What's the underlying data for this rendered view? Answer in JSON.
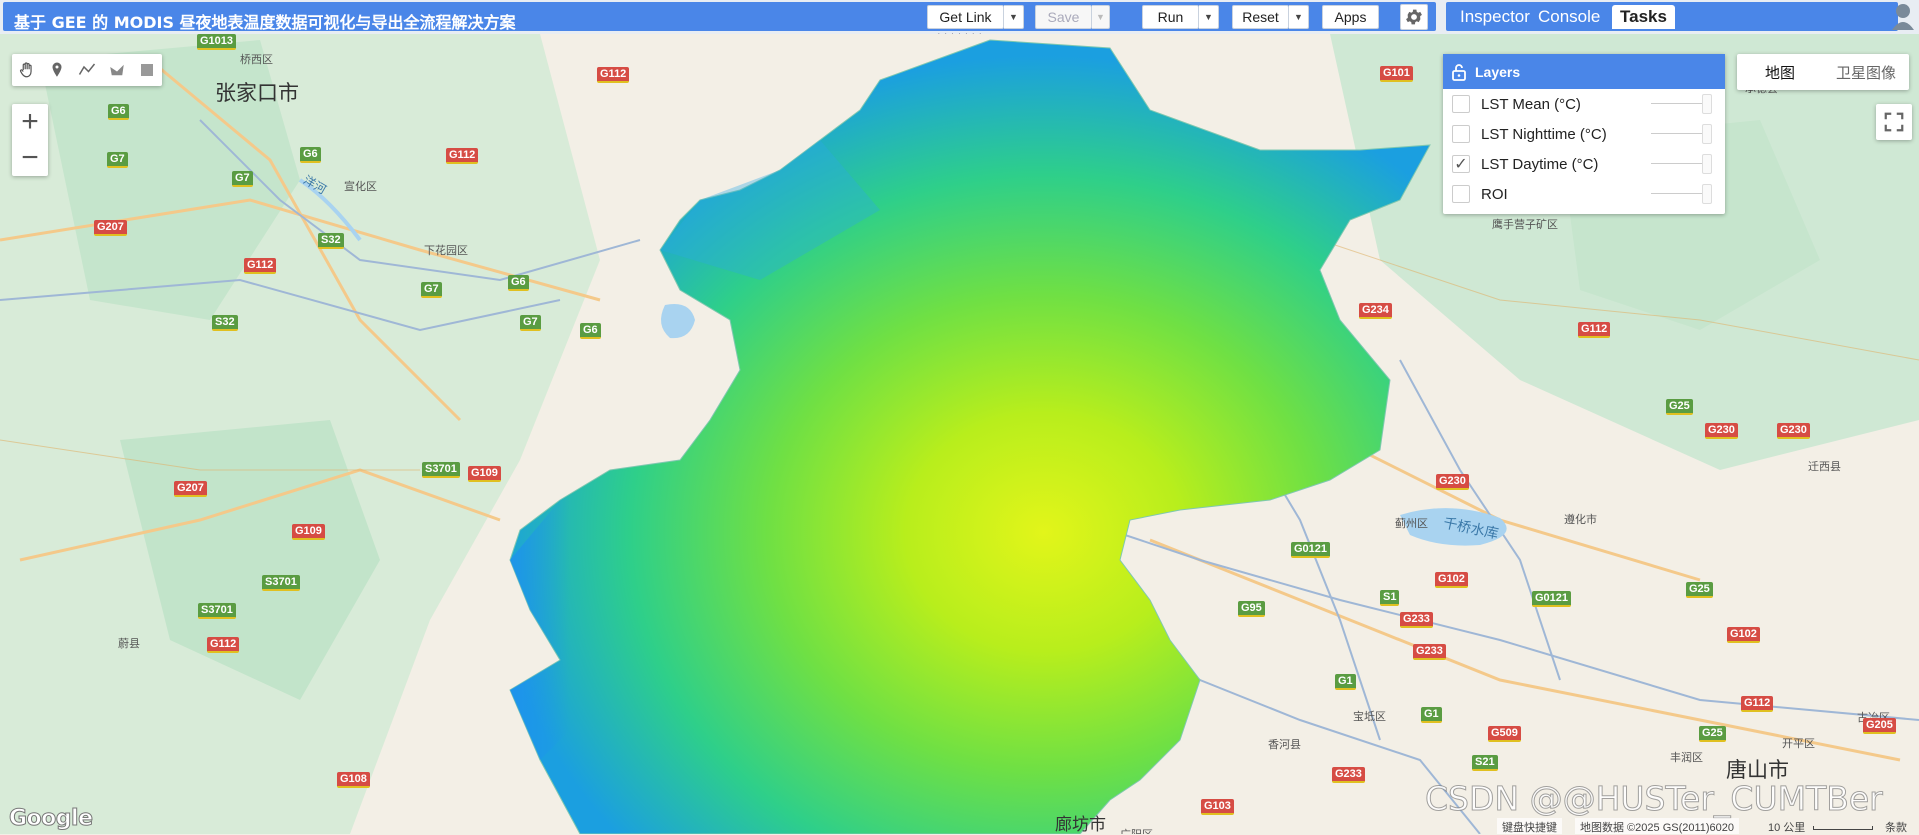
{
  "header": {
    "script_title": "基于 GEE 的 MODIS 昼夜地表温度数据可视化与导出全流程解决方案",
    "buttons": {
      "get_link": "Get Link",
      "save": "Save",
      "run": "Run",
      "reset": "Reset",
      "apps": "Apps"
    },
    "tabs": [
      "Inspector",
      "Console",
      "Tasks"
    ],
    "active_tab": "Tasks"
  },
  "map": {
    "map_types": [
      "地图",
      "卫星图像"
    ],
    "active_map_type": "地图",
    "layers_title": "Layers",
    "layers": [
      {
        "name": "LST Mean (°C)",
        "checked": false
      },
      {
        "name": "LST Nighttime (°C)",
        "checked": false
      },
      {
        "name": "LST Daytime (°C)",
        "checked": true
      },
      {
        "name": "ROI",
        "checked": false
      }
    ],
    "labels": {
      "cities": [
        "张家口市",
        "唐山市",
        "廊坊市"
      ],
      "districts": [
        "桥西区",
        "宣化区",
        "下花园区",
        "蔚县",
        "蓟州区",
        "遵化市",
        "迁西县",
        "鹰手营子矿区",
        "宝坻区",
        "香河县",
        "丰润区",
        "开平区",
        "古冶区",
        "承德县",
        "广阳区"
      ],
      "water": [
        "千桥水库",
        "洋河"
      ]
    },
    "road_shields": [
      "G6",
      "G7",
      "G112",
      "G207",
      "S32",
      "G109",
      "S3701",
      "G108",
      "G101",
      "G234",
      "G230",
      "G25",
      "G0121",
      "G102",
      "G95",
      "S1",
      "G233",
      "G1",
      "S21",
      "G509",
      "G103",
      "G205",
      "G1013"
    ],
    "google_logo": "Google",
    "attribution": {
      "shortcuts": "键盘快捷键",
      "data": "地图数据 ©2025 GS(2011)6020",
      "scale": "10 公里",
      "terms": "条款"
    },
    "watermark": "CSDN @@HUSTer_CUMTBer"
  },
  "colors": {
    "accent": "#4a86e8",
    "lst_low": "#1e8ff0",
    "lst_mid": "#37d96e",
    "lst_high": "#d8f51a"
  }
}
